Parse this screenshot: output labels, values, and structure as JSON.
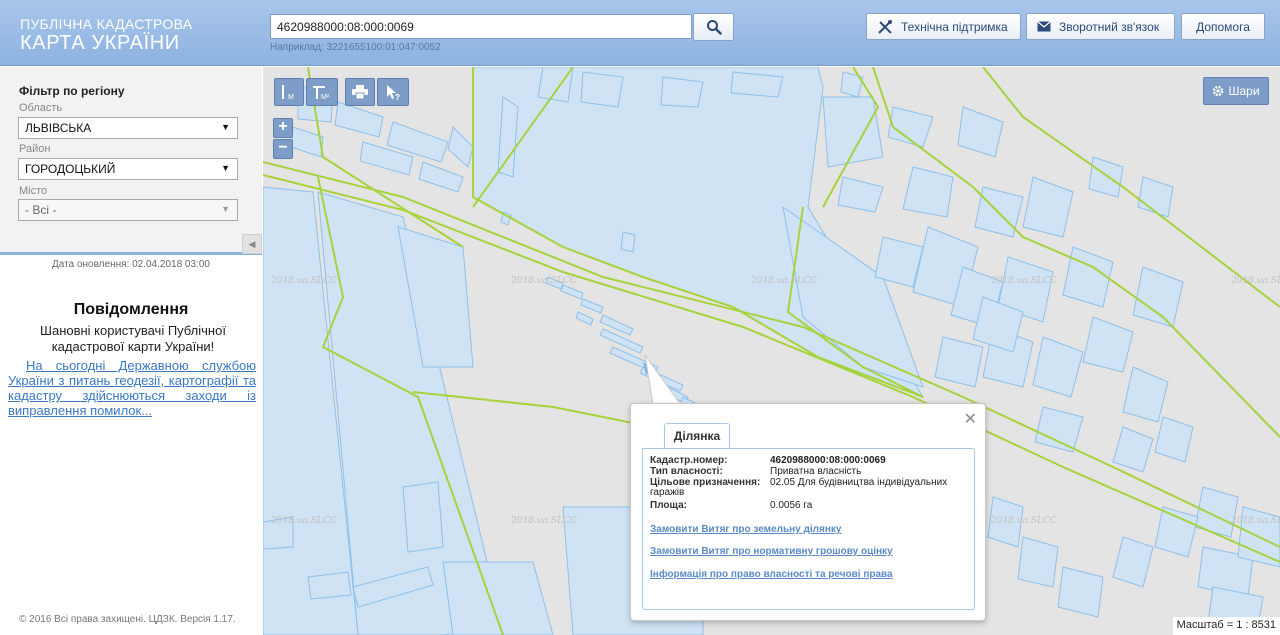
{
  "header": {
    "logo_line1": "ПУБЛІЧНА КАДАСТРОВА",
    "logo_line2": "КАРТА УКРАЇНИ",
    "search_value": "4620988000:08:000:0069",
    "search_hint": "Наприклад: 3221655100:01:047:0052",
    "buttons": {
      "support": "Технічна підтримка",
      "feedback": "Зворотний зв'язок",
      "help": "Допомога"
    }
  },
  "filter": {
    "title": "Фільтр по регіону",
    "oblast_label": "Область",
    "oblast_value": "ЛЬВІВСЬКА",
    "raion_label": "Район",
    "raion_value": "ГОРОДОЦЬКИЙ",
    "city_label": "Місто",
    "city_value": "- Всі -"
  },
  "update_date": "Дата оновлення: 02.04.2018 03:00",
  "notice": {
    "title": "Повідомлення",
    "body": "Шановні користувачі Публічної кадастрової карти України!",
    "link": "На сьогодні Державною службою України з питань геодезії, картографії та кадастру здійснюються заходи із виправлення помилок..."
  },
  "footer": "© 2016 Всі права захищені. ЦДЗК. Версія 1.17.",
  "map": {
    "layers_label": "Шари",
    "watermark": "2018.ua.SLCC",
    "scale": "Масштаб = 1 : 8531",
    "tools": {
      "ruler_unit": "M",
      "area_unit": "M²"
    }
  },
  "popup": {
    "tab": "Ділянка",
    "fields": {
      "cadnum_label": "Кадастр.номер:",
      "cadnum_value": "4620988000:08:000:0069",
      "ownership_label": "Тип власності:",
      "ownership_value": "Приватна власність",
      "purpose_label": "Цільове призначення:",
      "purpose_value": "02.05 Для будівництва індивідуальних гаражів",
      "area_label": "Площа:",
      "area_value": "0.0056 га"
    },
    "links": {
      "extract": "Замовити Витяг про земельну ділянку",
      "valuation": "Замовити Витяг про нормативну грошову оцінку",
      "rights": "Інформація про право власності та речові права"
    }
  },
  "colors": {
    "header_bg": "#8cb2e0",
    "parcel_fill": "#cfe3f5",
    "parcel_stroke": "#8ec0ea",
    "boundary": "#a6d23c",
    "link": "#3a78c3"
  }
}
